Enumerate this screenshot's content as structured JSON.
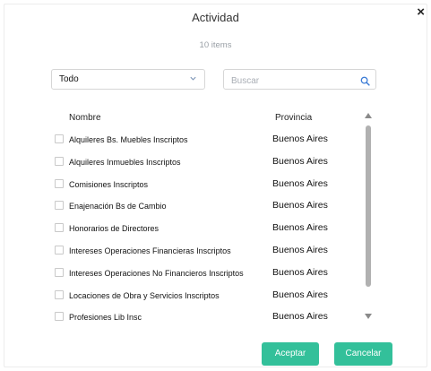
{
  "dialog": {
    "title": "Actividad",
    "count_text": "10 items",
    "close_label": "×"
  },
  "filter": {
    "selected": "Todo"
  },
  "search": {
    "placeholder": "Buscar",
    "value": ""
  },
  "table": {
    "columns": [
      "Nombre",
      "Provincia"
    ],
    "rows": [
      {
        "nombre": "Alquileres Bs. Muebles Inscriptos",
        "provincia": "Buenos Aires"
      },
      {
        "nombre": "Alquileres Inmuebles Inscriptos",
        "provincia": "Buenos Aires"
      },
      {
        "nombre": "Comisiones Inscriptos",
        "provincia": "Buenos Aires"
      },
      {
        "nombre": "Enajenación Bs de Cambio",
        "provincia": "Buenos Aires"
      },
      {
        "nombre": "Honorarios de Directores",
        "provincia": "Buenos Aires"
      },
      {
        "nombre": "Intereses Operaciones Financieras Inscriptos",
        "provincia": "Buenos Aires"
      },
      {
        "nombre": "Intereses Operaciones No Financieros Inscriptos",
        "provincia": "Buenos Aires"
      },
      {
        "nombre": "Locaciones de Obra y Servicios Inscriptos",
        "provincia": "Buenos Aires"
      },
      {
        "nombre": "Profesiones Lib Insc",
        "provincia": "Buenos Aires"
      }
    ]
  },
  "buttons": {
    "accept": "Aceptar",
    "cancel": "Cancelar"
  },
  "colors": {
    "accent": "#33c09a",
    "scrollbar": "#b1b1b1",
    "select_chevron": "#7a93b5",
    "search_icon": "#3a7bd5"
  },
  "icons": {
    "close": "close-icon",
    "dropdown": "chevron-down-icon",
    "search": "search-icon"
  }
}
